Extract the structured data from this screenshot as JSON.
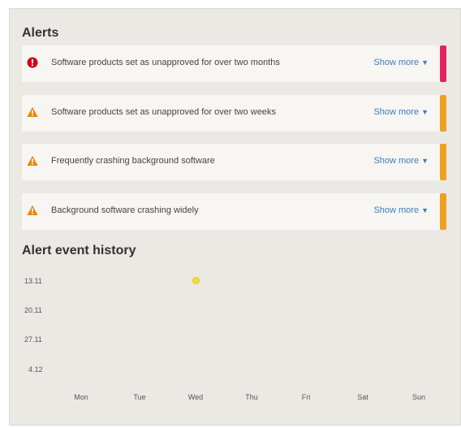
{
  "alerts": {
    "title": "Alerts",
    "show_more_label": "Show more",
    "caret": "▼",
    "items": [
      {
        "text": "Software products set as unapproved for over two months",
        "severity": "critical",
        "icon": "exclamation-circle-icon",
        "color": "#e0245e"
      },
      {
        "text": "Software products set as unapproved for over two weeks",
        "severity": "warning",
        "icon": "warning-triangle-icon",
        "color": "#f0a020"
      },
      {
        "text": "Frequently crashing background software",
        "severity": "warning",
        "icon": "warning-triangle-icon",
        "color": "#f0a020"
      },
      {
        "text": "Background software crashing widely",
        "severity": "warning",
        "icon": "warning-triangle-icon",
        "color": "#f0a020"
      }
    ]
  },
  "history": {
    "title": "Alert event history",
    "chart_data": {
      "type": "scatter",
      "weeks": [
        "13.11",
        "20.11",
        "27.11",
        "4.12"
      ],
      "days": [
        "Mon",
        "Tue",
        "Wed",
        "Thu",
        "Fri",
        "Sat",
        "Sun"
      ],
      "points": [
        {
          "week": "13.11",
          "day": "Wed",
          "color": "#f1e02c"
        }
      ]
    }
  }
}
